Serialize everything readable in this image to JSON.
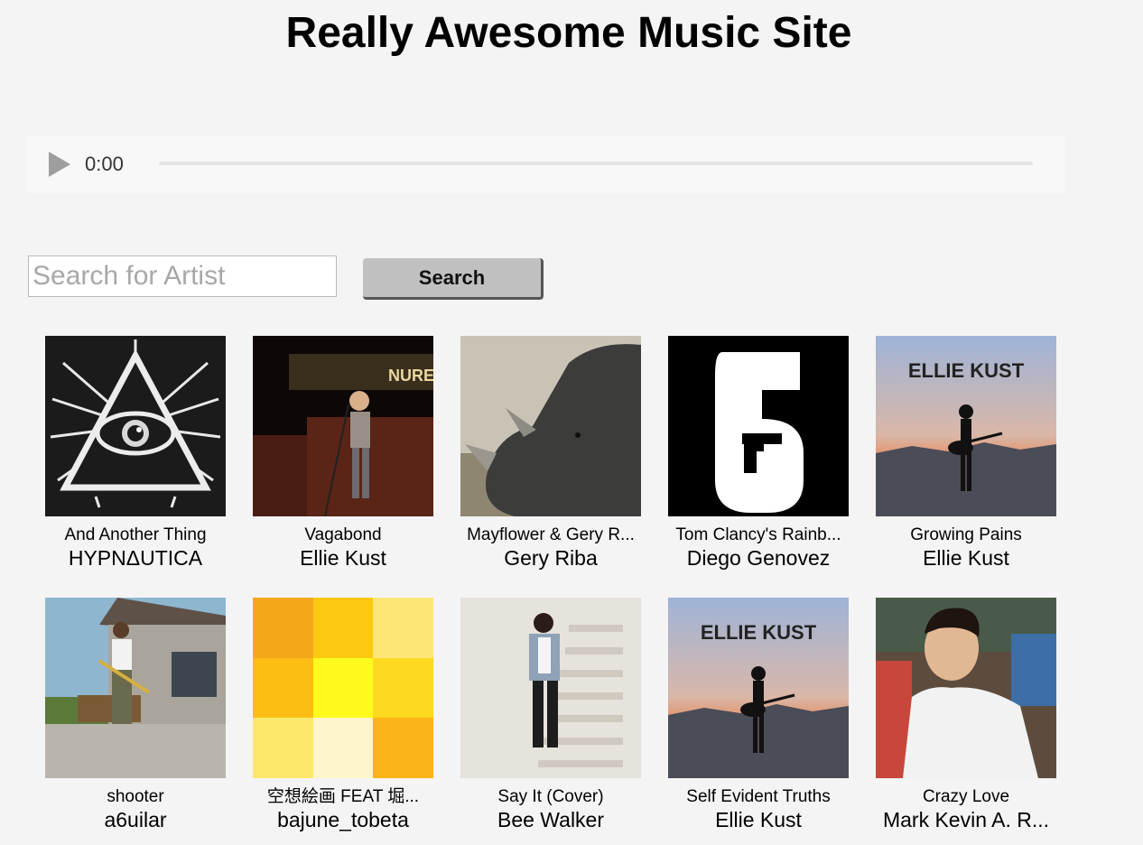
{
  "header": {
    "title": "Really Awesome Music Site"
  },
  "player": {
    "time": "0:00",
    "progress": 0
  },
  "search": {
    "placeholder": "Search for Artist",
    "button_label": "Search"
  },
  "results": [
    {
      "title": "And Another Thing",
      "artist": "HYPNΔUTICA",
      "cover": "illuminati-eye-artwork"
    },
    {
      "title": "Vagabond",
      "artist": "Ellie Kust",
      "cover": "singer-on-stage-photo"
    },
    {
      "title": "Mayflower & Gery R...",
      "artist": "Gery Riba",
      "cover": "rhino-photo"
    },
    {
      "title": "Tom Clancy's Rainb...",
      "artist": "Diego Genovez",
      "cover": "six-with-gun-logo"
    },
    {
      "title": "Growing Pains",
      "artist": "Ellie Kust",
      "cover": "ellie-kust-album-art",
      "cover_text": "ELLIE KUST"
    },
    {
      "title": "shooter",
      "artist": "a6uilar",
      "cover": "armed-man-in-driveway-photo"
    },
    {
      "title": "空想絵画 FEAT 堀...",
      "artist": "bajune_tobeta",
      "cover": "yellow-mosaic-artwork"
    },
    {
      "title": "Say It (Cover)",
      "artist": "Bee Walker",
      "cover": "man-on-stairs-photo"
    },
    {
      "title": "Self Evident Truths",
      "artist": "Ellie Kust",
      "cover": "ellie-kust-album-art",
      "cover_text": "ELLIE KUST"
    },
    {
      "title": "Crazy Love",
      "artist": "Mark Kevin A. R...",
      "cover": "man-in-white-shirt-photo"
    }
  ],
  "colors": {
    "background": "#f4f4f4",
    "button": "#c0c0c0",
    "button_shadow": "#555555"
  }
}
